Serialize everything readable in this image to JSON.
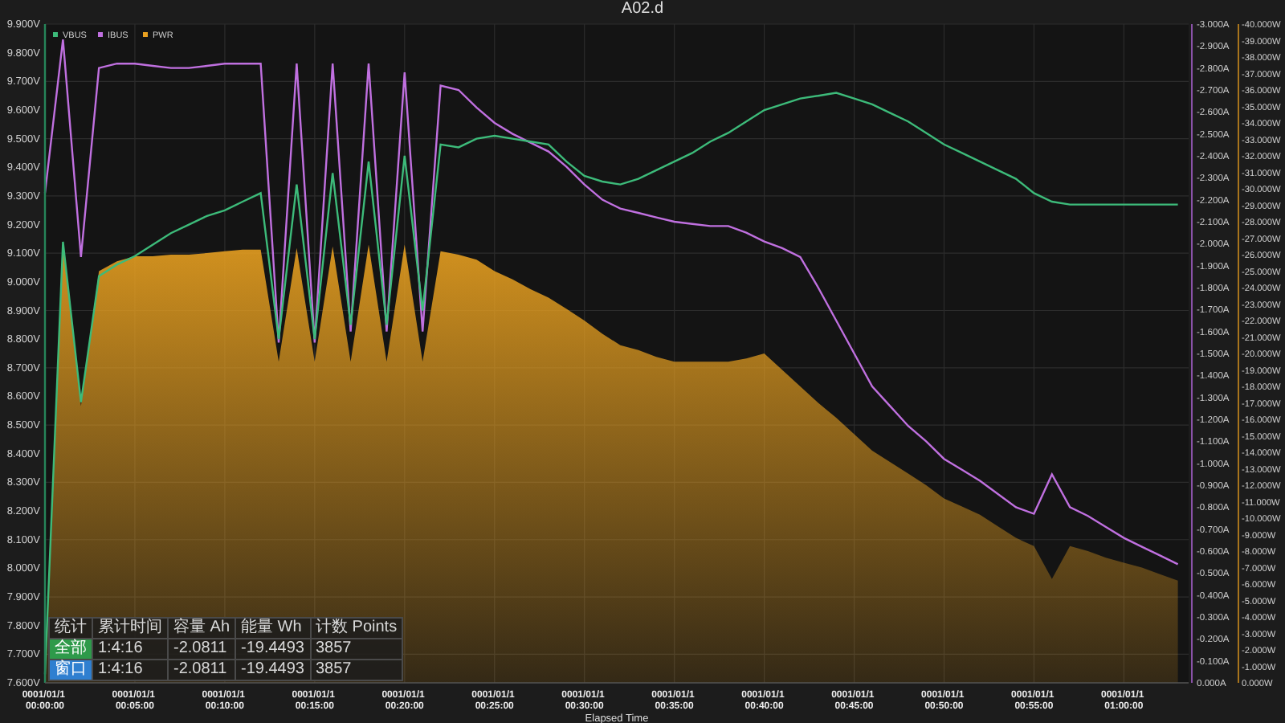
{
  "title": "A02.d",
  "chart": {
    "chart_data": {
      "type": "line",
      "grid": true,
      "legend": "upper left",
      "xlabel": "Elapsed Time",
      "ylim": [
        7.6,
        9.9
      ],
      "y2lim": [
        0,
        -3
      ],
      "y3lim": [
        0,
        -40
      ],
      "categories": [
        "0001/01/1 00:00:00",
        null,
        null,
        null,
        null,
        "0001/01/1 00:05:00",
        null,
        null,
        null,
        null,
        "0001/01/1 00:10:00",
        null,
        null,
        null,
        null,
        "0001/01/1 00:15:00",
        null,
        null,
        null,
        null,
        "0001/01/1 00:20:00",
        null,
        null,
        null,
        null,
        "0001/01/1 00:25:00",
        null,
        null,
        null,
        null,
        "0001/01/1 00:30:00",
        null,
        null,
        null,
        null,
        "0001/01/1 00:35:00",
        null,
        null,
        null,
        null,
        "0001/01/1 00:40:00",
        null,
        null,
        null,
        null,
        "0001/01/1 00:45:00",
        null,
        null,
        null,
        null,
        "0001/01/1 00:50:00",
        null,
        null,
        null,
        null,
        "0001/01/1 00:55:00",
        null,
        null,
        null,
        null,
        "0001/01/1 01:00:00",
        null,
        null,
        null
      ],
      "series": [
        {
          "name": "VBUS",
          "color": "#3dbb7a",
          "axis": "y",
          "values": [
            7.63,
            9.14,
            8.58,
            9.02,
            9.06,
            9.09,
            9.13,
            9.17,
            9.2,
            9.23,
            9.25,
            9.28,
            9.31,
            8.8,
            9.34,
            8.8,
            9.38,
            8.85,
            9.42,
            8.85,
            9.44,
            8.9,
            9.48,
            9.47,
            9.5,
            9.51,
            9.5,
            9.49,
            9.48,
            9.42,
            9.37,
            9.35,
            9.34,
            9.36,
            9.39,
            9.42,
            9.45,
            9.49,
            9.52,
            9.56,
            9.6,
            9.62,
            9.64,
            9.65,
            9.66,
            9.64,
            9.62,
            9.59,
            9.56,
            9.52,
            9.48,
            9.45,
            9.42,
            9.39,
            9.36,
            9.31,
            9.28,
            9.27,
            9.27,
            9.27,
            9.27,
            9.27,
            9.27,
            9.27
          ]
        },
        {
          "name": "IBUS",
          "color": "#c070e0",
          "axis": "y2",
          "values": [
            -2.23,
            -2.93,
            -1.94,
            -2.8,
            -2.82,
            -2.82,
            -2.81,
            -2.8,
            -2.8,
            -2.81,
            -2.82,
            -2.82,
            -2.82,
            -1.55,
            -2.82,
            -1.55,
            -2.82,
            -1.6,
            -2.82,
            -1.6,
            -2.78,
            -1.6,
            -2.72,
            -2.7,
            -2.62,
            -2.55,
            -2.5,
            -2.46,
            -2.42,
            -2.35,
            -2.27,
            -2.2,
            -2.16,
            -2.14,
            -2.12,
            -2.1,
            -2.09,
            -2.08,
            -2.08,
            -2.05,
            -2.01,
            -1.98,
            -1.94,
            -1.8,
            -1.65,
            -1.5,
            -1.35,
            -1.26,
            -1.17,
            -1.1,
            -1.02,
            -0.97,
            -0.92,
            -0.86,
            -0.8,
            -0.77,
            -0.95,
            -0.8,
            -0.76,
            -0.71,
            -0.66,
            -0.62,
            -0.58,
            -0.54
          ]
        },
        {
          "name": "PWR",
          "color": "#e8a020",
          "type": "area",
          "axis": "y3",
          "values": [
            -0.5,
            -26.8,
            -16.8,
            -25.0,
            -25.6,
            -25.9,
            -25.9,
            -26.0,
            -26.0,
            -26.1,
            -26.2,
            -26.3,
            -26.3,
            -19.5,
            -26.4,
            -19.5,
            -26.5,
            -19.5,
            -26.6,
            -19.5,
            -26.6,
            -19.5,
            -26.2,
            -26.0,
            -25.7,
            -25.0,
            -24.5,
            -23.9,
            -23.4,
            -22.7,
            -22.0,
            -21.2,
            -20.5,
            -20.2,
            -19.8,
            -19.5,
            -19.5,
            -19.5,
            -19.5,
            -19.7,
            -20.0,
            -19.0,
            -18.0,
            -17.0,
            -16.1,
            -15.1,
            -14.1,
            -13.4,
            -12.7,
            -12.0,
            -11.2,
            -10.7,
            -10.2,
            -9.5,
            -8.8,
            -8.3,
            -6.3,
            -8.3,
            -8.0,
            -7.6,
            -7.3,
            -7.0,
            -6.6,
            -6.2
          ]
        }
      ],
      "yticks": [
        {
          "value": 9.9,
          "label": "9.900V"
        },
        {
          "value": 9.8,
          "label": "9.800V"
        },
        {
          "value": 9.7,
          "label": "9.700V"
        },
        {
          "value": 9.6,
          "label": "9.600V"
        },
        {
          "value": 9.5,
          "label": "9.500V"
        },
        {
          "value": 9.4,
          "label": "9.400V"
        },
        {
          "value": 9.3,
          "label": "9.300V"
        },
        {
          "value": 9.2,
          "label": "9.200V"
        },
        {
          "value": 9.1,
          "label": "9.100V"
        },
        {
          "value": 9.0,
          "label": "9.000V"
        },
        {
          "value": 8.9,
          "label": "8.900V"
        },
        {
          "value": 8.8,
          "label": "8.800V"
        },
        {
          "value": 8.7,
          "label": "8.700V"
        },
        {
          "value": 8.6,
          "label": "8.600V"
        },
        {
          "value": 8.5,
          "label": "8.500V"
        },
        {
          "value": 8.4,
          "label": "8.400V"
        },
        {
          "value": 8.3,
          "label": "8.300V"
        },
        {
          "value": 8.2,
          "label": "8.200V"
        },
        {
          "value": 8.1,
          "label": "8.100V"
        },
        {
          "value": 8.0,
          "label": "8.000V"
        },
        {
          "value": 7.9,
          "label": "7.900V"
        },
        {
          "value": 7.8,
          "label": "7.800V"
        },
        {
          "value": 7.7,
          "label": "7.700V"
        },
        {
          "value": 7.6,
          "label": "7.600V"
        }
      ],
      "y2ticks": [
        {
          "value": -3,
          "label": "-3.000A"
        },
        {
          "value": -2.9,
          "label": "-2.900A"
        },
        {
          "value": -2.8,
          "label": "-2.800A"
        },
        {
          "value": -2.7,
          "label": "-2.700A"
        },
        {
          "value": -2.6,
          "label": "-2.600A"
        },
        {
          "value": -2.5,
          "label": "-2.500A"
        },
        {
          "value": -2.4,
          "label": "-2.400A"
        },
        {
          "value": -2.3,
          "label": "-2.300A"
        },
        {
          "value": -2.2,
          "label": "-2.200A"
        },
        {
          "value": -2.1,
          "label": "-2.100A"
        },
        {
          "value": -2.0,
          "label": "-2.000A"
        },
        {
          "value": -1.9,
          "label": "-1.900A"
        },
        {
          "value": -1.8,
          "label": "-1.800A"
        },
        {
          "value": -1.7,
          "label": "-1.700A"
        },
        {
          "value": -1.6,
          "label": "-1.600A"
        },
        {
          "value": -1.5,
          "label": "-1.500A"
        },
        {
          "value": -1.4,
          "label": "-1.400A"
        },
        {
          "value": -1.3,
          "label": "-1.300A"
        },
        {
          "value": -1.2,
          "label": "-1.200A"
        },
        {
          "value": -1.1,
          "label": "-1.100A"
        },
        {
          "value": -1.0,
          "label": "-1.000A"
        },
        {
          "value": -0.9,
          "label": "-0.900A"
        },
        {
          "value": -0.8,
          "label": "-0.800A"
        },
        {
          "value": -0.7,
          "label": "-0.700A"
        },
        {
          "value": -0.6,
          "label": "-0.600A"
        },
        {
          "value": -0.5,
          "label": "-0.500A"
        },
        {
          "value": -0.4,
          "label": "-0.400A"
        },
        {
          "value": -0.3,
          "label": "-0.300A"
        },
        {
          "value": -0.2,
          "label": "-0.200A"
        },
        {
          "value": -0.1,
          "label": "-0.100A"
        },
        {
          "value": 0,
          "label": "0.000A"
        }
      ],
      "y3ticks": [
        {
          "value": -40,
          "label": "-40.000W"
        },
        {
          "value": -39,
          "label": "-39.000W"
        },
        {
          "value": -38,
          "label": "-38.000W"
        },
        {
          "value": -37,
          "label": "-37.000W"
        },
        {
          "value": -36,
          "label": "-36.000W"
        },
        {
          "value": -35,
          "label": "-35.000W"
        },
        {
          "value": -34,
          "label": "-34.000W"
        },
        {
          "value": -33,
          "label": "-33.000W"
        },
        {
          "value": -32,
          "label": "-32.000W"
        },
        {
          "value": -31,
          "label": "-31.000W"
        },
        {
          "value": -30,
          "label": "-30.000W"
        },
        {
          "value": -29,
          "label": "-29.000W"
        },
        {
          "value": -28,
          "label": "-28.000W"
        },
        {
          "value": -27,
          "label": "-27.000W"
        },
        {
          "value": -26,
          "label": "-26.000W"
        },
        {
          "value": -25,
          "label": "-25.000W"
        },
        {
          "value": -24,
          "label": "-24.000W"
        },
        {
          "value": -23,
          "label": "-23.000W"
        },
        {
          "value": -22,
          "label": "-22.000W"
        },
        {
          "value": -21,
          "label": "-21.000W"
        },
        {
          "value": -20,
          "label": "-20.000W"
        },
        {
          "value": -19,
          "label": "-19.000W"
        },
        {
          "value": -18,
          "label": "-18.000W"
        },
        {
          "value": -17,
          "label": "-17.000W"
        },
        {
          "value": -16,
          "label": "-16.000W"
        },
        {
          "value": -15,
          "label": "-15.000W"
        },
        {
          "value": -14,
          "label": "-14.000W"
        },
        {
          "value": -13,
          "label": "-13.000W"
        },
        {
          "value": -12,
          "label": "-12.000W"
        },
        {
          "value": -11,
          "label": "-11.000W"
        },
        {
          "value": -10,
          "label": "-10.000W"
        },
        {
          "value": -9,
          "label": "-9.000W"
        },
        {
          "value": -8,
          "label": "-8.000W"
        },
        {
          "value": -7,
          "label": "-7.000W"
        },
        {
          "value": -6,
          "label": "-6.000W"
        },
        {
          "value": -5,
          "label": "-5.000W"
        },
        {
          "value": -4,
          "label": "-4.000W"
        },
        {
          "value": -3,
          "label": "-3.000W"
        },
        {
          "value": -2,
          "label": "-2.000W"
        },
        {
          "value": -1,
          "label": "-1.000W"
        },
        {
          "value": 0,
          "label": "0.000W"
        }
      ]
    }
  },
  "stats_table": {
    "columns": [
      "统计",
      "累计时间",
      "容量 Ah",
      "能量 Wh",
      "计数 Points"
    ],
    "rows": [
      {
        "color": "#2e9a4a",
        "cells": [
          "全部",
          "1:4:16",
          "-2.0811",
          "-19.4493",
          "3857"
        ]
      },
      {
        "color": "#2f7fd0",
        "cells": [
          "窗口",
          "1:4:16",
          "-2.0811",
          "-19.4493",
          "3857"
        ]
      }
    ]
  }
}
